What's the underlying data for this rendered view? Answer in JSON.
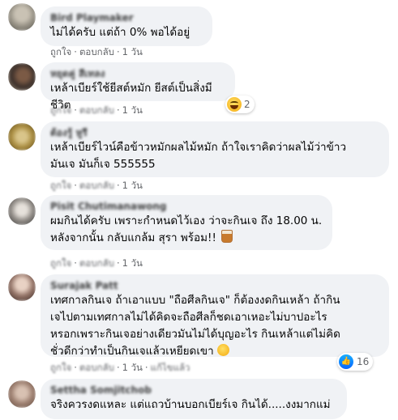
{
  "comments": [
    {
      "author": "Bird Playmaker",
      "text": "ไม่ได้ครับ แต่ถ้า 0% พอได้อยู่",
      "like": "ถูกใจ",
      "reply": "ตอบกลับ",
      "time": "1 วัน"
    },
    {
      "author": "หยุดคู่ สีเทลง",
      "text": "เหล้าเบียร์ใช้ยีสต์หมัก ยีสต์เป็นสิ่งมีชีวิต",
      "like": "ถูกใจ",
      "reply": "ตอบกลับ",
      "time": "1 วัน",
      "reaction_count": "2"
    },
    {
      "author": "ต้องรู้ หูรี",
      "text": "เหล้าเบียร์ไวน์คือข้าวหมักผลไม้หมัก ถ้าใจเราคิดว่าผลไม้ว่าข้าว\nมันเจ มันก็เจ 555555",
      "like": "ถูกใจ",
      "reply": "ตอบกลับ",
      "time": "1 วัน"
    },
    {
      "author": "Pisit Chutimanawong",
      "text": "ผมกินได้ครับ เพราะกำหนดไว้เอง ว่าจะกินเจ ถึง 18.00 น.\nหลังจากนั้น กลับแกล้ม สุรา พร้อม!!",
      "like": "ถูกใจ",
      "reply": "ตอบกลับ",
      "time": "1 วัน"
    },
    {
      "author": "Surajak Patt",
      "text": "เทศกาลกินเจ ถ้าเอาแบบ \"ถือศีลกินเจ\" ก็ต้องงดกินเหล้า ถ้ากิน\nเจไปตามเทศกาลไม่ได้คิดจะถือศีลก็ชดเอาเหอะไม่บาปอะไร\nหรอกเพราะกินเจอย่างเดียวมันไม่ได้บุญอะไร กินเหล้าแต่ไม่คิด\nชั่วดีกว่าทำเป็นกินเจแล้วเหยียดเขา",
      "like": "ถูกใจ",
      "reply": "ตอบกลับ",
      "time": "1 วัน",
      "edited": "แก้ไขแล้ว",
      "reaction_count": "16"
    },
    {
      "author": "Settha Somjitchob",
      "text": "จริงควรงดแหละ แต่แถวบ้านบอกเบียร์เจ กินได้.....งงมากแม่"
    }
  ],
  "colors": {
    "bubble": "#f0f2f5",
    "meta": "#65676b",
    "like_blue": "#0866ff"
  },
  "icons": {
    "haha_reaction": "haha-face-icon",
    "like_reaction": "thumbs-up-icon"
  }
}
